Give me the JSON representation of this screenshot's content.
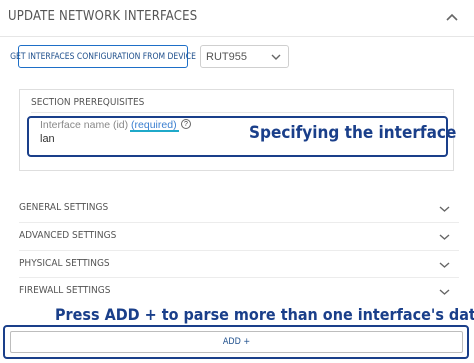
{
  "header": {
    "title": "UPDATE NETWORK INTERFACES",
    "collapse_icon": "chevron-up-icon"
  },
  "toolbar": {
    "get_config_label": "GET INTERFACES CONFIGURATION FROM DEVICE"
  },
  "device_select": {
    "value": "RUT955",
    "icon": "chevron-down-icon"
  },
  "prerequisites": {
    "title": "SECTION PREREQUISITES",
    "field": {
      "label": "Interface name (id)",
      "required": "(required)",
      "help_icon": "?",
      "value": "lan"
    }
  },
  "annotations": {
    "specify": "Specifying the interface",
    "press_add": "Press ADD + to parse more than one interface's data"
  },
  "sections": [
    {
      "label": "GENERAL SETTINGS"
    },
    {
      "label": "ADVANCED SETTINGS"
    },
    {
      "label": "PHYSICAL SETTINGS"
    },
    {
      "label": "FIREWALL SETTINGS"
    }
  ],
  "add_button": {
    "label": "ADD +"
  },
  "colors": {
    "accent": "#1e6fc7",
    "annotation": "#1a3f8a",
    "required_underline": "#1fa9c9"
  }
}
